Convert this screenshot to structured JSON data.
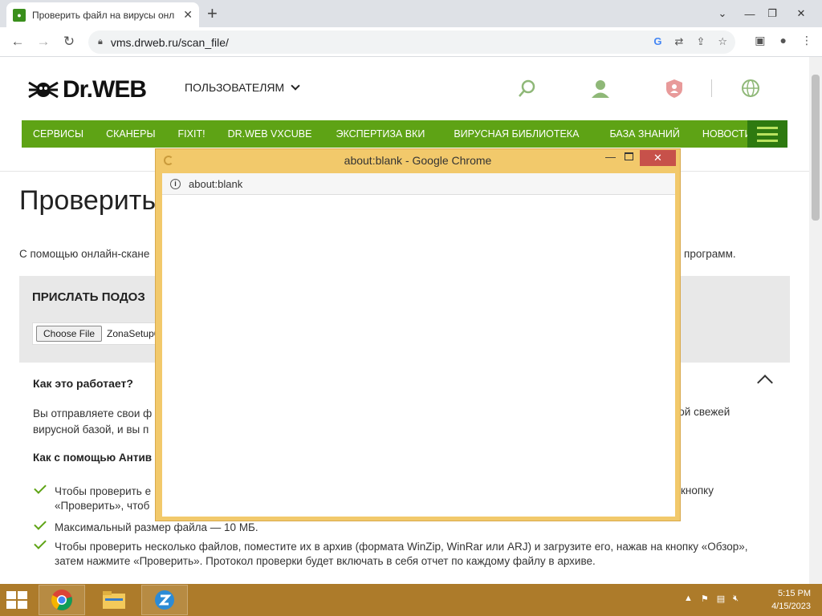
{
  "browser": {
    "tab_title": "Проверить файл на вирусы онл",
    "url": "vms.drweb.ru/scan_file/"
  },
  "site": {
    "logo_text": "Dr.WEB",
    "users_menu": "ПОЛЬЗОВАТЕЛЯМ",
    "nav": [
      "СЕРВИСЫ",
      "СКАНЕРЫ",
      "FIXIT!",
      "DR.WEB VXCUBE",
      "ЭКСПЕРТИЗА ВКИ",
      "ВИРУСНАЯ БИБЛИОТЕКА",
      "БАЗА ЗНАНИЙ",
      "НОВОСТИ"
    ],
    "heading": "Проверить",
    "intro_left": "С помощью онлайн-скане",
    "intro_right": "их программ.",
    "upload_title": "ПРИСЛАТЬ ПОДОЗ",
    "choose_file": "Choose File",
    "file_name": "ZonaSetup6",
    "how_title": "Как это работает?",
    "how_p1": "Вы отправляете свои ф",
    "how_p2": "вирусной базой, и вы п",
    "how_p_right": "мой свежей",
    "how_sub": "Как с помощью Антив",
    "list": [
      {
        "line1": "Чтобы проверить е",
        "line2": "«Проверить», чтоб",
        "right": "кнопку"
      },
      {
        "line1": "Максимальный размер файла — 10 МБ."
      },
      {
        "line1": "Чтобы проверить несколько файлов, поместите их в архив (формата WinZip, WinRar или ARJ) и загрузите его, нажав на кнопку «Обзор»,",
        "line2": "затем нажмите «Проверить». Протокол проверки будет включать в себя отчет по каждому файлу в архиве."
      }
    ],
    "green": "#5ea315"
  },
  "popup": {
    "title": "about:blank - Google Chrome",
    "address": "about:blank",
    "close_glyph": "✕"
  },
  "taskbar": {
    "time": "5:15 PM",
    "date": "4/15/2023"
  }
}
